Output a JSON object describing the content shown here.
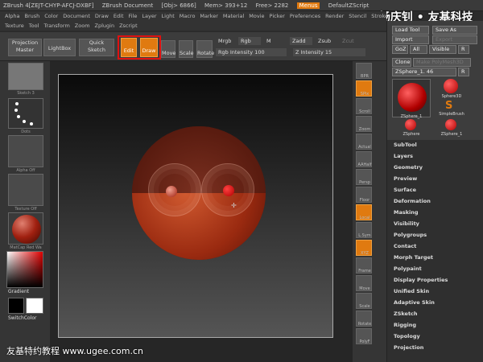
{
  "titlebar": {
    "app": "ZBrush 4[ZEJT-CHYP-AFCJ-DXBF]",
    "doc": "ZBrush Document",
    "obj": "[Obj> 6866]",
    "mem": "Mem> 393+12",
    "free": "Free> 2282",
    "menus": "Menus",
    "script": "DefaultZScript"
  },
  "watermark_top": "© 杨庆钊 • 友基科技",
  "watermark_bottom": "友基特约教程  www.ugee.com.cn",
  "menu_row1": [
    "Alpha",
    "Brush",
    "Color",
    "Document",
    "Draw",
    "Edit",
    "File",
    "Layer",
    "Light",
    "Macro",
    "Marker",
    "Material",
    "Movie",
    "Picker",
    "Preferences",
    "Render",
    "Stencil",
    "Stroke"
  ],
  "menu_row2": [
    "Texture",
    "Tool",
    "Transform",
    "Zoom",
    "Zplugin",
    "Zscript"
  ],
  "toolbar": {
    "projection_master": "Projection Master",
    "lightbox": "LightBox",
    "quick_sketch": "Quick Sketch",
    "edit": "Edit",
    "draw": "Draw",
    "move": "Move",
    "scale": "Scale",
    "rotate": "Rotate",
    "mrgb": "Mrgb",
    "rgb": "Rgb",
    "m": "M",
    "zadd": "Zadd",
    "zsub": "Zsub",
    "zcut": "Zcut",
    "rgb_intensity": "Rgb Intensity 100",
    "z_intensity": "Z Intensity 15"
  },
  "left_shelf": {
    "sketch": "Sketch 3",
    "dots": "Dots",
    "alpha": "Alpha Off",
    "texture": "Texture Off",
    "material": "MatCap Red Wa",
    "gradient": "Gradient",
    "switch_color": "SwitchColor"
  },
  "right_shelf": [
    "BPR",
    "SPix",
    "Scroll",
    "Zoom",
    "Actual",
    "AAHalf",
    "Persp",
    "Floor",
    "Local",
    "L.Sym",
    "XYZ",
    "Frame",
    "Move",
    "Scale",
    "Rotate",
    "PolyF"
  ],
  "tool_panel": {
    "load_tool": "Load Tool",
    "save_as": "Save As",
    "import": "Import",
    "export": "Export",
    "goz": "GoZ",
    "all": "All",
    "visible": "Visible",
    "r": "R",
    "clone": "Clone",
    "make_polymesh": "Make PolyMesh3D",
    "sphere_name": "ZSphere_1. 46",
    "thumb1": "ZSphere_1",
    "thumb2": "Sphere3D",
    "thumb3": "SimpleBrush",
    "thumb4": "ZSphere",
    "thumb5": "ZSphere_1"
  },
  "menu_list": [
    "SubTool",
    "Layers",
    "Geometry",
    "Preview",
    "Surface",
    "Deformation",
    "Masking",
    "Visibility",
    "Polygroups",
    "Contact",
    "Morph Target",
    "Polypaint",
    "Display Properties",
    "Unified Skin",
    "Adaptive Skin",
    "ZSketch",
    "Rigging",
    "Topology",
    "Projection"
  ],
  "colors": {
    "accent": "#e07a10",
    "highlight": "#e01010",
    "sphere": "#a02010"
  }
}
